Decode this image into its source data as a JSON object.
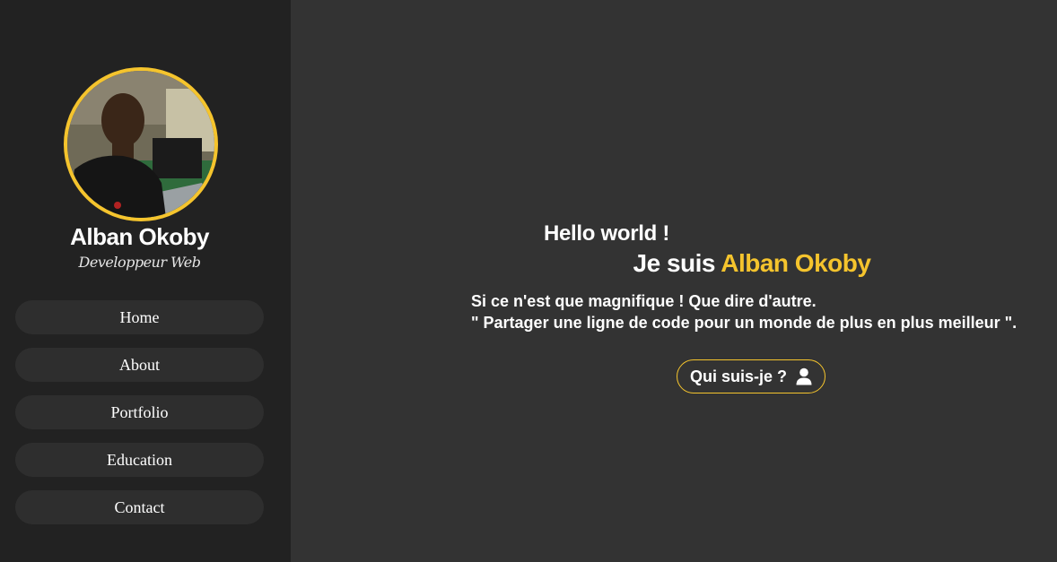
{
  "profile": {
    "name": "Alban Okoby",
    "role": "Developpeur Web",
    "avatar": "profile-photo"
  },
  "nav": {
    "items": [
      {
        "label": "Home"
      },
      {
        "label": "About"
      },
      {
        "label": "Portfolio"
      },
      {
        "label": "Education"
      },
      {
        "label": "Contact"
      }
    ]
  },
  "hero": {
    "greeting": "Hello world !",
    "intro_prefix": "Je suis",
    "intro_name": "Alban Okoby",
    "line1": "Si ce n'est que magnifique ! Que dire d'autre.",
    "line2": "\" Partager une ligne de code pour un monde de plus en plus meilleur \".",
    "cta_label": "Qui suis-je ?",
    "cta_icon": "user-icon"
  },
  "colors": {
    "accent": "#f5c42d",
    "sidebar_bg": "#222222",
    "main_bg": "#333333",
    "nav_item_bg": "#2e2e2e"
  }
}
